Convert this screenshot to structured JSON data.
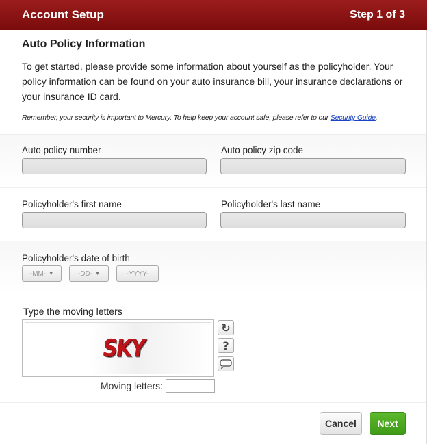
{
  "header": {
    "title": "Account Setup",
    "step": "Step 1 of 3",
    "background_color": "#8b1515"
  },
  "intro": {
    "heading": "Auto Policy Information",
    "lead_text": "To get started, please provide some information about yourself as the policyholder. Your policy information can be found on your auto insurance bill, your insurance declarations or your insurance ID card.",
    "note_text": "Remember, your security is important to Mercury. To help keep your account safe, please refer to our ",
    "note_link": "Security Guide",
    "note_end": "."
  },
  "fields": {
    "policy_number": {
      "label": "Auto policy number",
      "value": ""
    },
    "zip_code": {
      "label": "Auto policy zip code",
      "value": ""
    },
    "first_name": {
      "label": "Policyholder's first name",
      "value": ""
    },
    "last_name": {
      "label": "Policyholder's last name",
      "value": ""
    },
    "dob": {
      "label": "Policyholder's date of birth",
      "month": "-MM-",
      "day": "-DD-",
      "year": "-YYYY-"
    }
  },
  "captcha": {
    "label": "Type the moving letters",
    "word": "SKY",
    "refresh_icon": "refresh-icon",
    "help_icon": "help-icon",
    "audio_icon": "speech-bubble-icon",
    "help_glyph": "?",
    "refresh_glyph": "↻",
    "input_label": "Moving letters:",
    "input_value": ""
  },
  "buttons": {
    "cancel": "Cancel",
    "next": "Next",
    "next_color": "#4ca822"
  }
}
